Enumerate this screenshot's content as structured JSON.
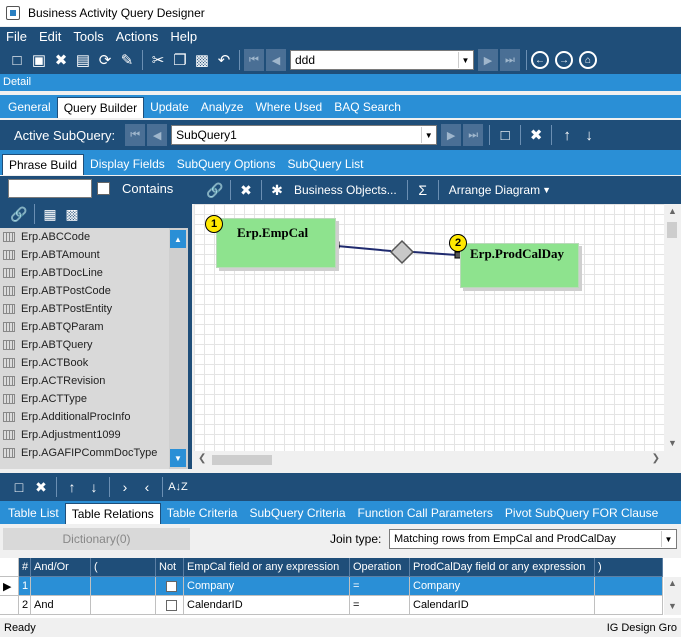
{
  "window": {
    "title": "Business Activity Query Designer"
  },
  "menu": [
    "File",
    "Edit",
    "Tools",
    "Actions",
    "Help"
  ],
  "toolbar": {
    "query_value": "ddd"
  },
  "detail_label": "Detail",
  "main_tabs": [
    "General",
    "Query Builder",
    "Update",
    "Analyze",
    "Where Used",
    "BAQ Search"
  ],
  "subquery": {
    "label": "Active SubQuery:",
    "value": "SubQuery1"
  },
  "sub_tabs": [
    "Phrase Build",
    "Display Fields",
    "SubQuery Options",
    "SubQuery List"
  ],
  "search": {
    "value": "",
    "contains_label": "Contains"
  },
  "diagram_toolbar": {
    "business_objects": "Business Objects...",
    "arrange": "Arrange Diagram"
  },
  "tables": [
    "Erp.ABCCode",
    "Erp.ABTAmount",
    "Erp.ABTDocLine",
    "Erp.ABTPostCode",
    "Erp.ABTPostEntity",
    "Erp.ABTQParam",
    "Erp.ABTQuery",
    "Erp.ACTBook",
    "Erp.ACTRevision",
    "Erp.ACTType",
    "Erp.AdditionalProcInfo",
    "Erp.Adjustment1099",
    "Erp.AGAFIPCommDocType"
  ],
  "diagram": {
    "node1": {
      "num": "1",
      "name": "Erp.EmpCal"
    },
    "node2": {
      "num": "2",
      "name": "Erp.ProdCalDay"
    }
  },
  "lower_tabs": [
    "Table List",
    "Table Relations",
    "Table Criteria",
    "SubQuery Criteria",
    "Function Call Parameters",
    "Pivot SubQuery FOR Clause"
  ],
  "relations": {
    "dictionary_label": "Dictionary(0)",
    "join_label": "Join type:",
    "join_value": "Matching rows from EmpCal and ProdCalDay",
    "headers": [
      "#",
      "And/Or",
      "(",
      "Not",
      "EmpCal field or any expression",
      "Operation",
      "ProdCalDay field or any expression",
      ")"
    ],
    "rows": [
      {
        "num": "1",
        "andor": "",
        "paren": "",
        "left": "Company",
        "op": "=",
        "right": "Company",
        "close": ""
      },
      {
        "num": "2",
        "andor": "And",
        "paren": "",
        "left": "CalendarID",
        "op": "=",
        "right": "CalendarID",
        "close": ""
      }
    ]
  },
  "status": {
    "left": "Ready",
    "right": "IG Design Gro"
  }
}
